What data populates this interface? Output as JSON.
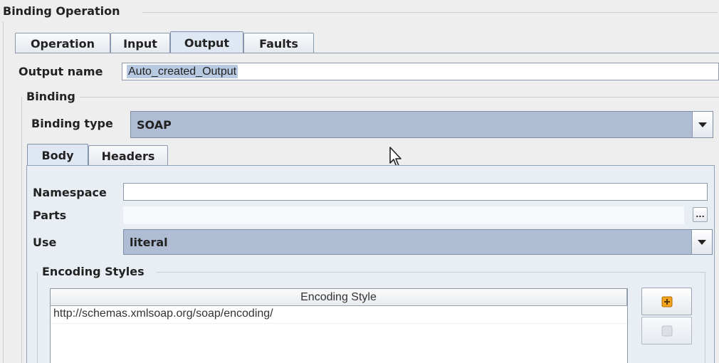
{
  "group_title": "Binding Operation",
  "tabs": [
    {
      "label": "Operation",
      "selected": false
    },
    {
      "label": "Input",
      "selected": false
    },
    {
      "label": "Output",
      "selected": true
    },
    {
      "label": "Faults",
      "selected": false
    }
  ],
  "output_name": {
    "label": "Output name",
    "value": "Auto_created_Output"
  },
  "binding_group": {
    "title": "Binding",
    "binding_type_label": "Binding type",
    "binding_type_value": "SOAP"
  },
  "inner_tabs": [
    {
      "label": "Body",
      "selected": true
    },
    {
      "label": "Headers",
      "selected": false
    }
  ],
  "body": {
    "namespace_label": "Namespace",
    "namespace_value": "",
    "parts_label": "Parts",
    "parts_value": "",
    "parts_button": "...",
    "use_label": "Use",
    "use_value": "literal",
    "encoding_styles": {
      "title": "Encoding Styles",
      "column_header": "Encoding Style",
      "rows": [
        "http://schemas.xmlsoap.org/soap/encoding/"
      ]
    }
  },
  "colors": {
    "background": "#eeeeee",
    "selected_combo": "#aebdd3",
    "tab_panel": "#e9eef5",
    "add_icon": "#f2a51c"
  }
}
